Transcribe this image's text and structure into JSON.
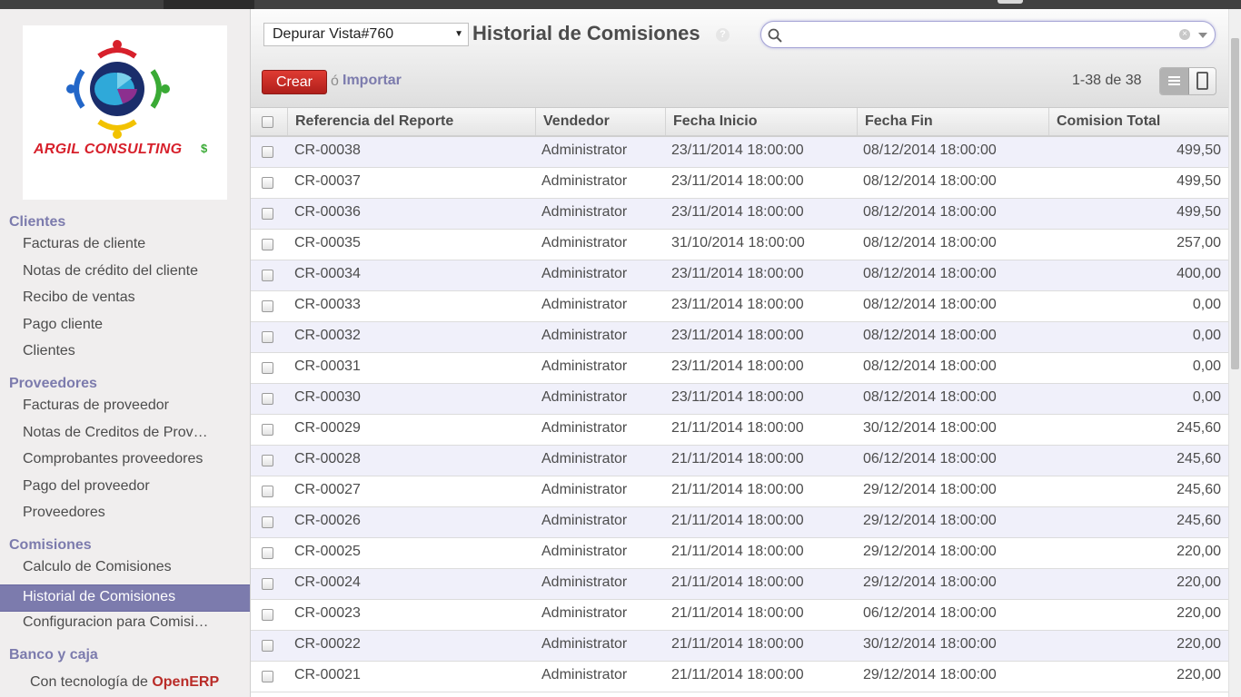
{
  "sidebar": {
    "logo_text": "ARGIL CONSULTING",
    "sections": [
      {
        "title": "Clientes",
        "items": [
          "Facturas de cliente",
          "Notas de crédito del cliente",
          "Recibo de ventas",
          "Pago cliente",
          "Clientes"
        ]
      },
      {
        "title": "Proveedores",
        "items": [
          "Facturas de proveedor",
          "Notas de Creditos de Prov…",
          "Comprobantes proveedores",
          "Pago del proveedor",
          "Proveedores"
        ]
      },
      {
        "title": "Comisiones",
        "items": [
          "Calculo de Comisiones",
          "Historial de Comisiones",
          "Configuracion para Comisi…"
        ]
      },
      {
        "title": "Banco y caja",
        "items": []
      }
    ],
    "active_item": "Historial de Comisiones",
    "powered_prefix": "Con tecnología de",
    "powered_brand": "OpenERP"
  },
  "header": {
    "view_select": "Depurar Vista#760",
    "title": "Historial de Comisiones",
    "help": "?",
    "search_placeholder": "",
    "create_label": "Crear",
    "or_text": "ó",
    "import_label": "Importar",
    "pager": "1-38 de 38"
  },
  "table": {
    "columns": [
      "Referencia del Reporte",
      "Vendedor",
      "Fecha Inicio",
      "Fecha Fin",
      "Comision Total"
    ],
    "rows": [
      [
        "CR-00038",
        "Administrator",
        "23/11/2014 18:00:00",
        "08/12/2014 18:00:00",
        "499,50"
      ],
      [
        "CR-00037",
        "Administrator",
        "23/11/2014 18:00:00",
        "08/12/2014 18:00:00",
        "499,50"
      ],
      [
        "CR-00036",
        "Administrator",
        "23/11/2014 18:00:00",
        "08/12/2014 18:00:00",
        "499,50"
      ],
      [
        "CR-00035",
        "Administrator",
        "31/10/2014 18:00:00",
        "08/12/2014 18:00:00",
        "257,00"
      ],
      [
        "CR-00034",
        "Administrator",
        "23/11/2014 18:00:00",
        "08/12/2014 18:00:00",
        "400,00"
      ],
      [
        "CR-00033",
        "Administrator",
        "23/11/2014 18:00:00",
        "08/12/2014 18:00:00",
        "0,00"
      ],
      [
        "CR-00032",
        "Administrator",
        "23/11/2014 18:00:00",
        "08/12/2014 18:00:00",
        "0,00"
      ],
      [
        "CR-00031",
        "Administrator",
        "23/11/2014 18:00:00",
        "08/12/2014 18:00:00",
        "0,00"
      ],
      [
        "CR-00030",
        "Administrator",
        "23/11/2014 18:00:00",
        "08/12/2014 18:00:00",
        "0,00"
      ],
      [
        "CR-00029",
        "Administrator",
        "21/11/2014 18:00:00",
        "30/12/2014 18:00:00",
        "245,60"
      ],
      [
        "CR-00028",
        "Administrator",
        "21/11/2014 18:00:00",
        "06/12/2014 18:00:00",
        "245,60"
      ],
      [
        "CR-00027",
        "Administrator",
        "21/11/2014 18:00:00",
        "29/12/2014 18:00:00",
        "245,60"
      ],
      [
        "CR-00026",
        "Administrator",
        "21/11/2014 18:00:00",
        "29/12/2014 18:00:00",
        "245,60"
      ],
      [
        "CR-00025",
        "Administrator",
        "21/11/2014 18:00:00",
        "29/12/2014 18:00:00",
        "220,00"
      ],
      [
        "CR-00024",
        "Administrator",
        "21/11/2014 18:00:00",
        "29/12/2014 18:00:00",
        "220,00"
      ],
      [
        "CR-00023",
        "Administrator",
        "21/11/2014 18:00:00",
        "06/12/2014 18:00:00",
        "220,00"
      ],
      [
        "CR-00022",
        "Administrator",
        "21/11/2014 18:00:00",
        "30/12/2014 18:00:00",
        "220,00"
      ],
      [
        "CR-00021",
        "Administrator",
        "21/11/2014 18:00:00",
        "29/12/2014 18:00:00",
        "220,00"
      ]
    ]
  },
  "colors": {
    "accent": "#7c7bad",
    "create_button": "#c8312b",
    "row_alt": "#f0f0fa",
    "brand_red": "#d7202b"
  },
  "icons": {
    "help": "question-icon",
    "search": "search-icon",
    "clear": "clear-icon",
    "dropdown": "dropdown-icon",
    "list_view": "list-view-icon",
    "form_view": "form-view-icon"
  }
}
